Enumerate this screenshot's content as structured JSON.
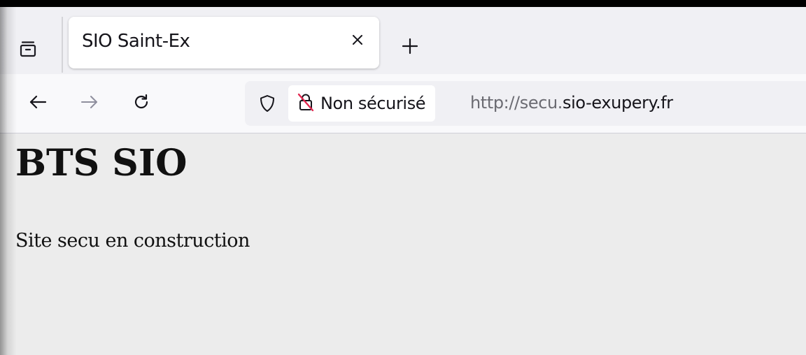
{
  "browser": {
    "tab": {
      "title": "SIO Saint-Ex",
      "close_icon": "close-icon"
    },
    "new_tab_icon": "plus-icon",
    "tab_overview_icon": "tab-list-icon",
    "nav": {
      "back_icon": "arrow-left-icon",
      "forward_icon": "arrow-right-icon",
      "reload_icon": "reload-icon"
    },
    "urlbar": {
      "tracking_icon": "shield-icon",
      "security_icon": "insecure-lock-icon",
      "security_label": "Non sécurisé",
      "url_prefix": "http://secu.",
      "url_domain": "sio-exupery.fr"
    },
    "colors": {
      "insecure_accent": "#e22850",
      "text": "#15141a",
      "url_dim": "#6b6b72"
    }
  },
  "page": {
    "heading": "BTS SIO",
    "text": "Site secu en construction"
  }
}
